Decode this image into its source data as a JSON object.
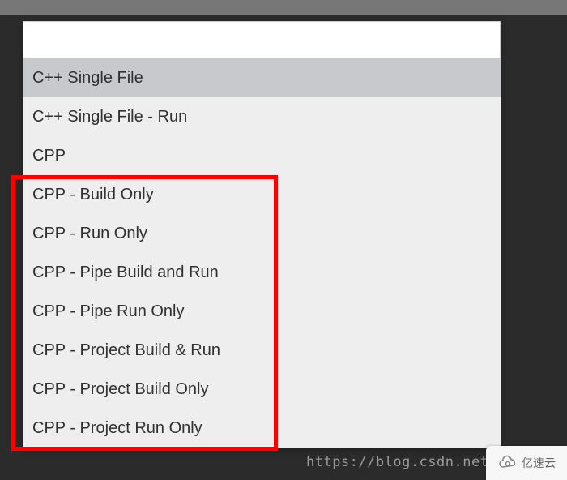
{
  "search": {
    "value": "",
    "placeholder": ""
  },
  "items": [
    {
      "label": "C++ Single File",
      "selected": true
    },
    {
      "label": "C++ Single File - Run",
      "selected": false
    },
    {
      "label": "CPP",
      "selected": false
    },
    {
      "label": "CPP - Build Only",
      "selected": false
    },
    {
      "label": "CPP - Run Only",
      "selected": false
    },
    {
      "label": "CPP - Pipe Build and Run",
      "selected": false
    },
    {
      "label": "CPP - Pipe Run Only",
      "selected": false
    },
    {
      "label": "CPP - Project Build & Run",
      "selected": false
    },
    {
      "label": "CPP - Project Build Only",
      "selected": false
    },
    {
      "label": "CPP - Project Run Only",
      "selected": false
    }
  ],
  "watermark": {
    "url": "https://blog.csdn.net/",
    "brand": "亿速云"
  }
}
